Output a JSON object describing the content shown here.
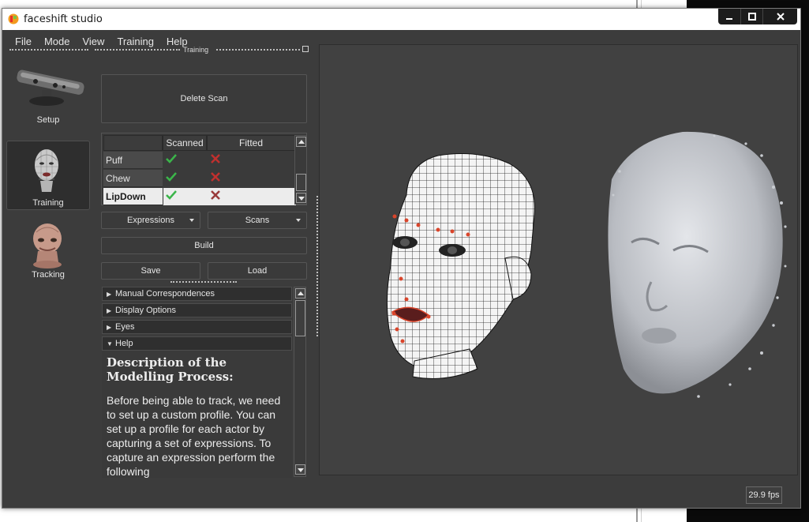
{
  "window": {
    "title": "faceshift studio",
    "controls": [
      "minimize",
      "maximize",
      "close"
    ]
  },
  "menu": {
    "items": [
      "File",
      "Mode",
      "View",
      "Training",
      "Help"
    ]
  },
  "modes": [
    {
      "label": "Setup",
      "icon": "camera-sensor-icon",
      "active": false
    },
    {
      "label": "Training",
      "icon": "head-mesh-icon",
      "active": true
    },
    {
      "label": "Tracking",
      "icon": "alien-head-icon",
      "active": false
    }
  ],
  "dock": {
    "title": "Training"
  },
  "buttons": {
    "delete_scan": "Delete Scan",
    "expressions": "Expressions",
    "scans": "Scans",
    "build": "Build",
    "save": "Save",
    "load": "Load"
  },
  "table": {
    "headers": [
      "",
      "Scanned",
      "Fitted"
    ],
    "rows": [
      {
        "name": "Puff",
        "scanned": true,
        "fitted": false,
        "selected": false
      },
      {
        "name": "Chew",
        "scanned": true,
        "fitted": false,
        "selected": false
      },
      {
        "name": "LipDown",
        "scanned": true,
        "fitted": false,
        "selected": true
      }
    ]
  },
  "toolbox": {
    "sections": [
      {
        "label": "Manual Correspondences",
        "expanded": false
      },
      {
        "label": "Display Options",
        "expanded": false
      },
      {
        "label": "Eyes",
        "expanded": false
      },
      {
        "label": "Help",
        "expanded": true
      }
    ],
    "help_title": "Description of the Modelling Process:",
    "help_text": "Before being able to track, we need to set up a custom profile. You can set up a profile for each actor by capturing a set of expressions. To capture an expression perform the following"
  },
  "status": {
    "fps": "29.9 fps"
  },
  "colors": {
    "background": "#3c3c3c",
    "check": "#3bb54a",
    "cross": "#c0302e",
    "marker": "#d9452b"
  }
}
